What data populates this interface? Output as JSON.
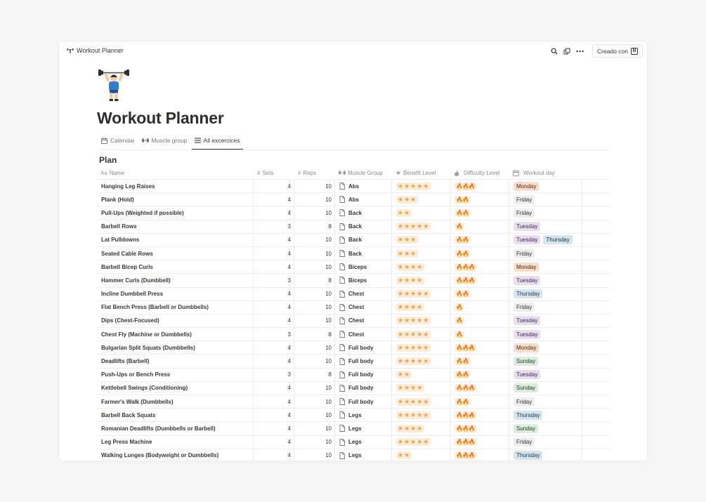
{
  "breadcrumb": "Workout Planner",
  "top_actions": {
    "created_label": "Creado con"
  },
  "page_title": "Workout Planner",
  "tabs": [
    {
      "label": "Calendar",
      "icon": "calendar-icon",
      "active": false
    },
    {
      "label": "Muscle group",
      "icon": "dumbbell-icon",
      "active": false
    },
    {
      "label": "All excercices",
      "icon": "list-icon",
      "active": true
    }
  ],
  "section_title": "Plan",
  "columns": {
    "name": "Name",
    "sets": "Sets",
    "reps": "Reps",
    "muscle_group": "Muscle Group",
    "benefit": "Benefit Level",
    "difficulty": "Difficulty Level",
    "day": "Workout day"
  },
  "colors": {
    "Monday": {
      "bg": "#fadec9",
      "fg": "#49290e"
    },
    "Tuesday": {
      "bg": "#e8deee",
      "fg": "#412454"
    },
    "Thursday": {
      "bg": "#d3e5ef",
      "fg": "#183347"
    },
    "Friday": {
      "bg": "#eeeeed",
      "fg": "#32302c"
    },
    "Sunday": {
      "bg": "#dbeddb",
      "fg": "#1c3829"
    }
  },
  "rows": [
    {
      "name": "Hanging Leg Raises",
      "sets": "4",
      "reps": "10",
      "group": "Abs",
      "benefit": "★★★★★",
      "difficulty": "🔥🔥🔥",
      "days": [
        "Monday"
      ]
    },
    {
      "name": "Plank (Hold)",
      "sets": "4",
      "reps": "10",
      "group": "Abs",
      "benefit": "★★★",
      "difficulty": "🔥🔥",
      "days": [
        "Friday"
      ]
    },
    {
      "name": "Pull-Ups (Weighted if possible)",
      "sets": "4",
      "reps": "10",
      "group": "Back",
      "benefit": "★★",
      "difficulty": "🔥🔥",
      "days": [
        "Friday"
      ]
    },
    {
      "name": "Barbell Rows",
      "sets": "3",
      "reps": "8",
      "group": "Back",
      "benefit": "★★★★★",
      "difficulty": "🔥",
      "days": [
        "Tuesday"
      ]
    },
    {
      "name": "Lat Pulldowns",
      "sets": "4",
      "reps": "10",
      "group": "Back",
      "benefit": "★★★",
      "difficulty": "🔥🔥",
      "days": [
        "Tuesday",
        "Thursday"
      ]
    },
    {
      "name": "Seated Cable Rows",
      "sets": "4",
      "reps": "10",
      "group": "Back",
      "benefit": "★★★",
      "difficulty": "🔥🔥",
      "days": [
        "Friday"
      ]
    },
    {
      "name": "Barbell Bicep Curls",
      "sets": "4",
      "reps": "10",
      "group": "Biceps",
      "benefit": "★★★★",
      "difficulty": "🔥🔥🔥",
      "days": [
        "Monday"
      ]
    },
    {
      "name": "Hammer Curls (Dumbbell)",
      "sets": "3",
      "reps": "8",
      "group": "Biceps",
      "benefit": "★★★★",
      "difficulty": "🔥🔥🔥",
      "days": [
        "Tuesday"
      ]
    },
    {
      "name": "Incline Dumbbell Press",
      "sets": "4",
      "reps": "10",
      "group": "Chest",
      "benefit": "★★★★★",
      "difficulty": "🔥🔥",
      "days": [
        "Thursday"
      ]
    },
    {
      "name": "Flat Bench Press (Barbell or Dumbbells)",
      "sets": "4",
      "reps": "10",
      "group": "Chest",
      "benefit": "★★★★",
      "difficulty": "🔥",
      "days": [
        "Friday"
      ]
    },
    {
      "name": "Dips (Chest-Focused)",
      "sets": "4",
      "reps": "10",
      "group": "Chest",
      "benefit": "★★★★★",
      "difficulty": "🔥",
      "days": [
        "Tuesday"
      ]
    },
    {
      "name": "Chest Fly (Machine or Dumbbells)",
      "sets": "3",
      "reps": "8",
      "group": "Chest",
      "benefit": "★★★★★",
      "difficulty": "🔥",
      "days": [
        "Tuesday"
      ]
    },
    {
      "name": "Bulgarian Split Squats (Dumbbells)",
      "sets": "4",
      "reps": "10",
      "group": "Full body",
      "benefit": "★★★★★",
      "difficulty": "🔥🔥🔥",
      "days": [
        "Monday"
      ]
    },
    {
      "name": "Deadlifts (Barbell)",
      "sets": "4",
      "reps": "10",
      "group": "Full body",
      "benefit": "★★★★★",
      "difficulty": "🔥🔥",
      "days": [
        "Sunday"
      ]
    },
    {
      "name": "Push-Ups or Bench Press",
      "sets": "3",
      "reps": "8",
      "group": "Full body",
      "benefit": "★★",
      "difficulty": "🔥🔥",
      "days": [
        "Tuesday"
      ]
    },
    {
      "name": "Kettlebell Swings (Conditioning)",
      "sets": "4",
      "reps": "10",
      "group": "Full body",
      "benefit": "★★★★",
      "difficulty": "🔥🔥🔥",
      "days": [
        "Sunday"
      ]
    },
    {
      "name": "Farmer's Walk (Dumbbells)",
      "sets": "4",
      "reps": "10",
      "group": "Full body",
      "benefit": "★★★★★",
      "difficulty": "🔥🔥",
      "days": [
        "Friday"
      ]
    },
    {
      "name": "Barbell Back Squats",
      "sets": "4",
      "reps": "10",
      "group": "Legs",
      "benefit": "★★★★★",
      "difficulty": "🔥🔥🔥",
      "days": [
        "Thursday"
      ]
    },
    {
      "name": "Romanian Deadlifts (Dumbbells or Barbell)",
      "sets": "4",
      "reps": "10",
      "group": "Legs",
      "benefit": "★★★★",
      "difficulty": "🔥🔥🔥",
      "days": [
        "Sunday"
      ]
    },
    {
      "name": "Leg Press Machine",
      "sets": "4",
      "reps": "10",
      "group": "Legs",
      "benefit": "★★★★★",
      "difficulty": "🔥🔥🔥",
      "days": [
        "Friday"
      ]
    },
    {
      "name": "Walking Lunges (Bodyweight or Dumbbells)",
      "sets": "4",
      "reps": "10",
      "group": "Legs",
      "benefit": "★★",
      "difficulty": "🔥🔥🔥",
      "days": [
        "Thursday"
      ]
    }
  ]
}
